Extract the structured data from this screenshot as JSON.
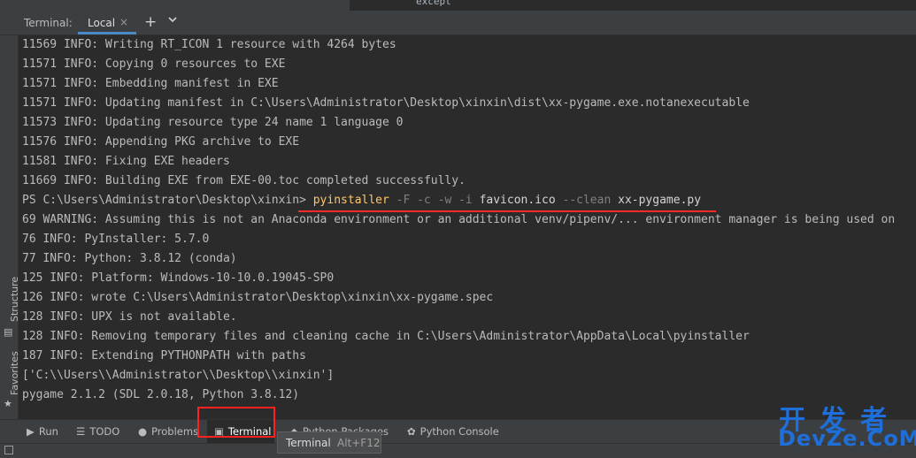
{
  "top": {
    "except_text": "except"
  },
  "tabbar": {
    "label": "Terminal:",
    "tab_name": "Local",
    "close": "×",
    "plus": "+"
  },
  "sidebar": {
    "structure": "Structure",
    "favorites": "Favorites"
  },
  "terminal": {
    "lines": [
      "11569 INFO: Writing RT_ICON 1 resource with 4264 bytes",
      "11571 INFO: Copying 0 resources to EXE",
      "11571 INFO: Embedding manifest in EXE",
      "11571 INFO: Updating manifest in C:\\Users\\Administrator\\Desktop\\xinxin\\dist\\xx-pygame.exe.notanexecutable",
      "11573 INFO: Updating resource type 24 name 1 language 0",
      "11576 INFO: Appending PKG archive to EXE",
      "11581 INFO: Fixing EXE headers",
      "11669 INFO: Building EXE from EXE-00.toc completed successfully."
    ],
    "prompt": "PS C:\\Users\\Administrator\\Desktop\\xinxin> ",
    "cmd_name": "pyinstaller",
    "cmd_opt1": " -F -c -w -i",
    "cmd_arg1": " favicon.ico",
    "cmd_opt2": " --clean",
    "cmd_arg2": " xx-pygame.py",
    "lines2": [
      "69 WARNING: Assuming this is not an Anaconda environment or an additional venv/pipenv/... environment manager is being used on",
      "76 INFO: PyInstaller: 5.7.0",
      "77 INFO: Python: 3.8.12 (conda)",
      "125 INFO: Platform: Windows-10-10.0.19045-SP0",
      "126 INFO: wrote C:\\Users\\Administrator\\Desktop\\xinxin\\xx-pygame.spec",
      "128 INFO: UPX is not available.",
      "128 INFO: Removing temporary files and cleaning cache in C:\\Users\\Administrator\\AppData\\Local\\pyinstaller",
      "187 INFO: Extending PYTHONPATH with paths",
      "['C:\\\\Users\\\\Administrator\\\\Desktop\\\\xinxin']",
      "pygame 2.1.2 (SDL 2.0.18, Python 3.8.12)"
    ]
  },
  "bottom": {
    "run": "Run",
    "todo": "TODO",
    "problems": "Problems",
    "terminal": "Terminal",
    "python_packages": "Python Packages",
    "python_console": "Python Console"
  },
  "tooltip": {
    "title": "Terminal",
    "shortcut": "Alt+F12"
  },
  "watermark": {
    "cn": "开发者",
    "en": "DevZe.CoM"
  }
}
